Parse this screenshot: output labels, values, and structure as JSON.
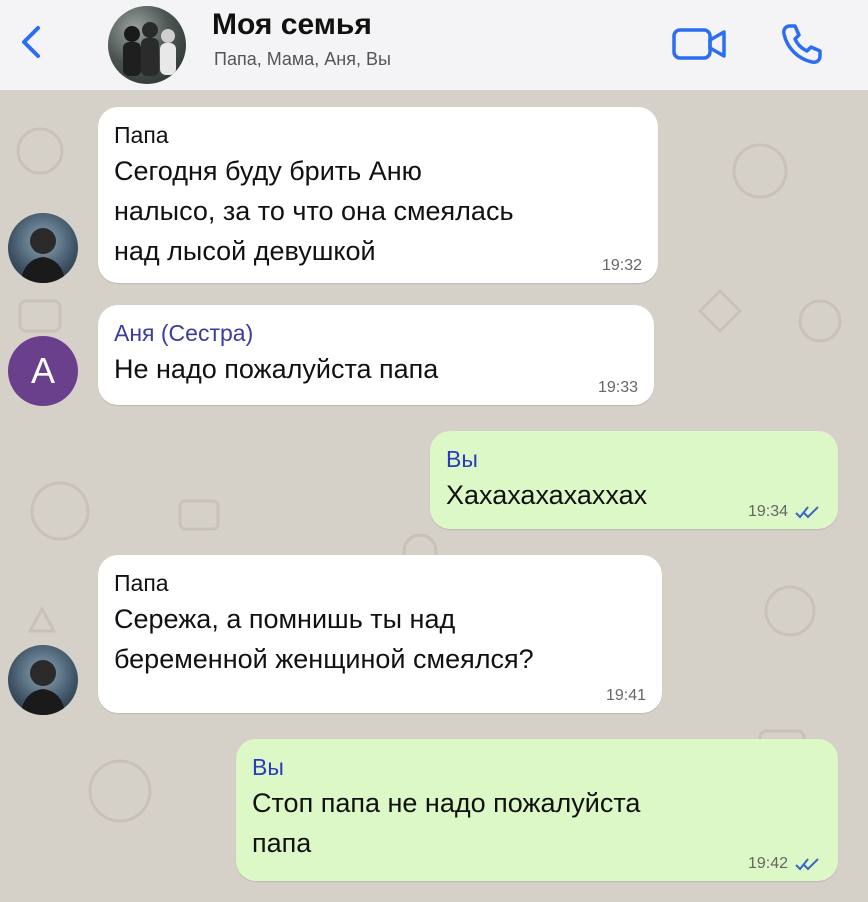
{
  "header": {
    "title": "Моя семья",
    "subtitle": "Папа, Мама, Аня, Вы",
    "back_icon": "chevron-left-icon",
    "video_icon": "video-call-icon",
    "phone_icon": "phone-icon"
  },
  "colors": {
    "incoming": "#ffffff",
    "outgoing": "#dcf8c6",
    "accent": "#2b6ef2"
  },
  "messages": [
    {
      "sender": "Папа",
      "text_lines": [
        "Сегодня буду брить Аню",
        "налысо, за то что она смеялась",
        "над лысой девушкой"
      ],
      "time": "19:32"
    },
    {
      "sender": "Аня (Сестра)",
      "avatar_letter": "А",
      "text_lines": [
        "Не надо пожалуйста папа"
      ],
      "time": "19:33"
    },
    {
      "sender": "Вы",
      "text_lines": [
        "Хахахахахаххах"
      ],
      "time": "19:34"
    },
    {
      "sender": "Папа",
      "text_lines": [
        "Сережа, а помнишь ты над",
        "беременной женщиной смеялся?"
      ],
      "time": "19:41"
    },
    {
      "sender": "Вы",
      "text_lines": [
        "Стоп папа не надо пожалуйста",
        "папа"
      ],
      "time": "19:42"
    }
  ]
}
